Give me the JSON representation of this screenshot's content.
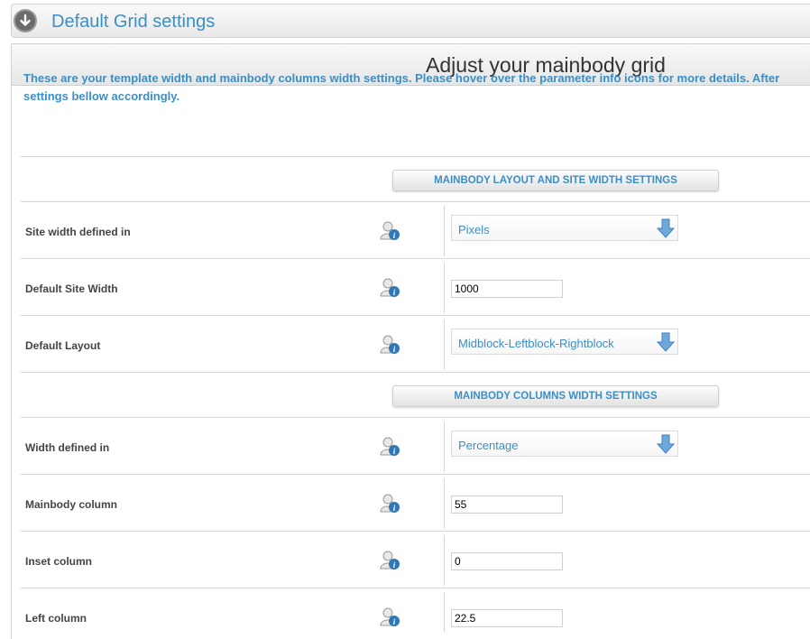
{
  "header": {
    "title": "Default Grid settings",
    "toggle_icon": "arrow-down-circle-icon"
  },
  "panel": {
    "title": "Adjust your mainbody grid",
    "intro_line1": "These are your template width and mainbody columns width settings. Please hover over the parameter info icons for more details. After",
    "intro_line2": "settings bellow accordingly."
  },
  "sections": {
    "layout": "MAINBODY LAYOUT AND SITE WIDTH SETTINGS",
    "columns": "MAINBODY COLUMNS WIDTH SETTINGS"
  },
  "fields": {
    "site_width_unit": {
      "label": "Site width defined in",
      "value": "Pixels"
    },
    "default_site_width": {
      "label": "Default Site Width",
      "value": "1000"
    },
    "default_layout": {
      "label": "Default Layout",
      "value": "Midblock-Leftblock-Rightblock"
    },
    "width_defined_in": {
      "label": "Width defined in",
      "value": "Percentage"
    },
    "mainbody_column": {
      "label": "Mainbody column",
      "value": "55"
    },
    "inset_column": {
      "label": "Inset column",
      "value": "0"
    },
    "left_column": {
      "label": "Left column",
      "value": "22.5"
    }
  },
  "icons": {
    "info": "user-info-icon",
    "select_arrow": "arrow-down-icon"
  },
  "colors": {
    "accent": "#3b8fc6",
    "label": "#444444",
    "border": "#d6d6d6"
  }
}
